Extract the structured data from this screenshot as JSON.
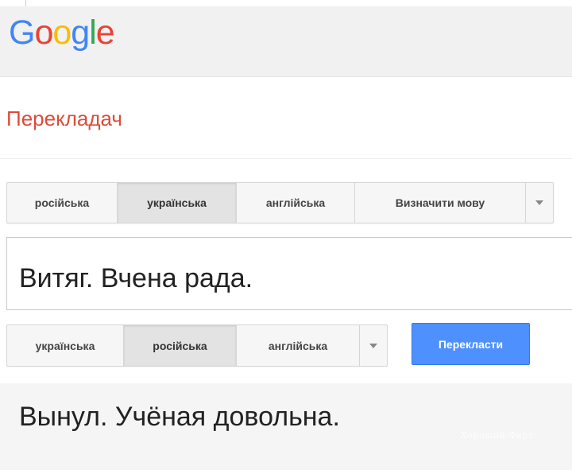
{
  "header": {
    "logo": [
      "G",
      "o",
      "o",
      "g",
      "l",
      "e"
    ],
    "logo_colors": [
      "#4285f4",
      "#ea4335",
      "#fbbc05",
      "#4285f4",
      "#34a853",
      "#ea4335"
    ]
  },
  "app": {
    "title": "Перекладач"
  },
  "source_languages": {
    "buttons": [
      "російська",
      "українська",
      "англійська",
      "Визначити мову"
    ],
    "selected": "українська",
    "dropdown_icon": "chevron-down-icon"
  },
  "source": {
    "text": "Витяг. Вчена рада."
  },
  "target_languages": {
    "buttons": [
      "українська",
      "російська",
      "англійська"
    ],
    "selected": "російська",
    "dropdown_icon": "chevron-down-icon"
  },
  "translate_button": {
    "label": "Перекласти"
  },
  "result": {
    "text": "Вынул. Учёная довольна."
  },
  "watermark": {
    "text": "Хороший Фарт"
  },
  "colors": {
    "accent_blue": "#4d90fe",
    "title_red": "#dd4b39"
  }
}
